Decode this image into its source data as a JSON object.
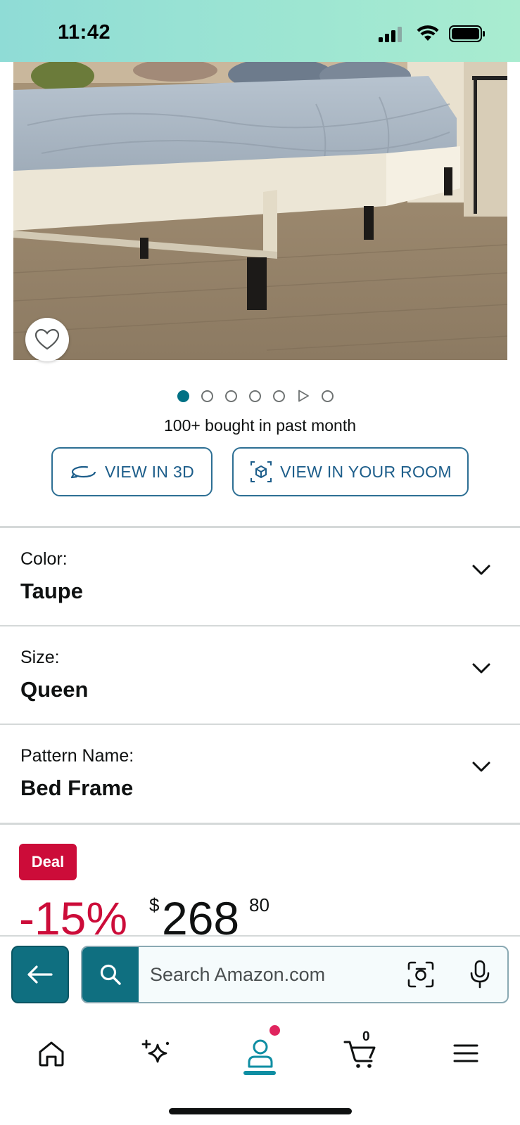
{
  "status_bar": {
    "time": "11:42"
  },
  "product": {
    "image_alt": "Upholstered bed frame with grey bedding on wood floor",
    "bought_text": "100+ bought in past month",
    "carousel": {
      "image_count": 6,
      "has_video": true,
      "active_index": 0
    }
  },
  "buttons": {
    "view_3d": "VIEW IN 3D",
    "view_room": "VIEW IN YOUR ROOM"
  },
  "variations": [
    {
      "label": "Color:",
      "value": "Taupe"
    },
    {
      "label": "Size:",
      "value": "Queen"
    },
    {
      "label": "Pattern Name:",
      "value": "Bed Frame"
    }
  ],
  "deal": {
    "badge": "Deal",
    "discount": "-15%",
    "currency": "$",
    "price_whole": "268",
    "price_fraction": "80"
  },
  "search": {
    "placeholder": "Search Amazon.com"
  },
  "nav": {
    "cart_count": "0"
  },
  "colors": {
    "accent_teal": "#0f6f80",
    "deal_red": "#cc0c39",
    "link_blue": "#1c5d8a"
  },
  "icons": {
    "back": "arrow-left-icon",
    "search": "search-icon",
    "lens": "camera-lens-icon",
    "mic": "microphone-icon",
    "home": "home-icon",
    "rufus": "sparkle-icon",
    "account": "person-icon",
    "cart": "cart-icon",
    "menu": "hamburger-menu-icon",
    "wishlist": "heart-icon"
  }
}
